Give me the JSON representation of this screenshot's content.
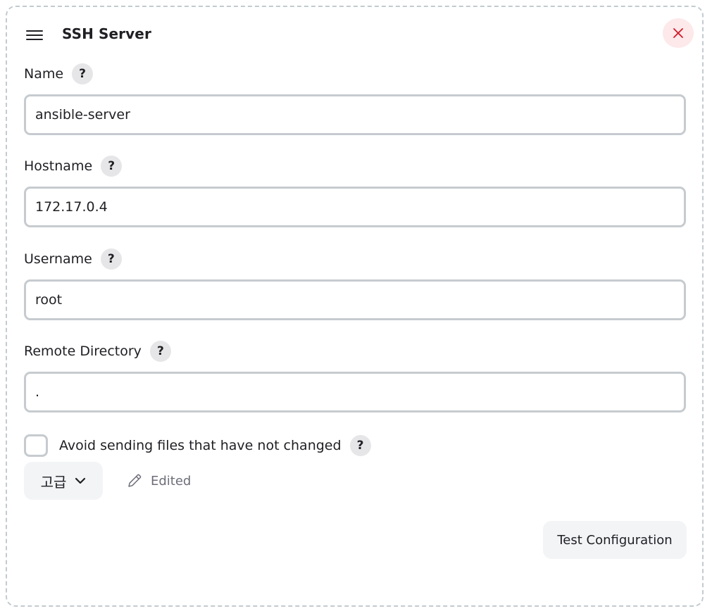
{
  "header": {
    "title": "SSH Server",
    "drag_icon": "hamburger-drag-icon",
    "close_icon": "close-icon"
  },
  "fields": {
    "name": {
      "label": "Name",
      "value": "ansible-server",
      "help": "?"
    },
    "hostname": {
      "label": "Hostname",
      "value": "172.17.0.4",
      "help": "?"
    },
    "username": {
      "label": "Username",
      "value": "root",
      "help": "?"
    },
    "remote_directory": {
      "label": "Remote Directory",
      "value": ".",
      "help": "?"
    }
  },
  "options": {
    "avoid_sending_label": "Avoid sending files that have not changed",
    "avoid_sending_checked": false,
    "help": "?"
  },
  "advanced": {
    "label": "고급",
    "icon": "chevron-down-icon"
  },
  "edited": {
    "label": "Edited",
    "icon": "pencil-icon"
  },
  "actions": {
    "test_label": "Test Configuration"
  },
  "colors": {
    "close_bg": "#fde8ea",
    "close_icon": "#d11a2a",
    "input_border": "#c6cbcf",
    "button_bg": "#f3f4f6",
    "muted_text": "#6d6e78"
  }
}
